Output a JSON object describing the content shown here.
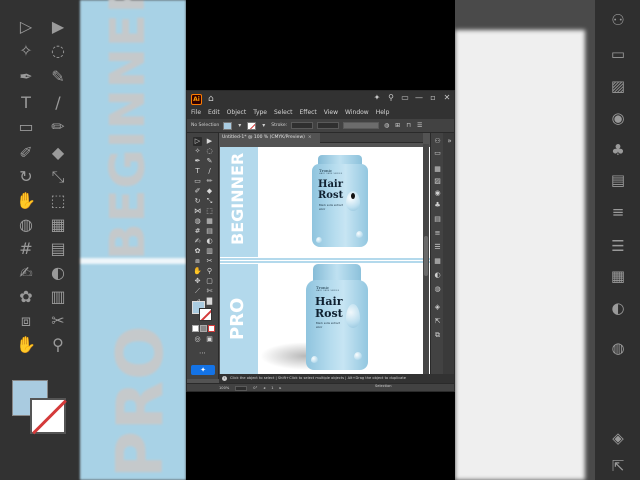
{
  "app": {
    "titlebar_icons": [
      "home-icon",
      "share-icon",
      "search-icon",
      "arrange-icon",
      "minimize-icon",
      "maximize-icon",
      "close-icon"
    ],
    "menu": [
      "File",
      "Edit",
      "Object",
      "Type",
      "Select",
      "Effect",
      "View",
      "Window",
      "Help"
    ],
    "control_bar": {
      "selection_label": "No Selection",
      "stroke_label": "Stroke:",
      "fill_color": "#a9cbe0"
    },
    "document_tab": {
      "label": "Untitled-1* @ 100 % (CMYK/Preview)",
      "close": "×"
    },
    "hint": {
      "text": "Click the object to select  |  Shift+Click to select multiple objects  |  Alt+Drag the object to duplicate"
    },
    "status": {
      "zoom": "100%",
      "angle": "0°",
      "artboard": "1",
      "tool": "Selection"
    }
  },
  "artboard": {
    "accent_color": "#b3d9ec",
    "top_label": "BEGINNER",
    "bottom_label": "PRO",
    "beginner_bottle": {
      "brand": "Tronic",
      "brand_sub": "HAIR CARE SERIES",
      "title_line1": "Hair",
      "title_line2": "Rost",
      "subtitle_line1": "Black soda extract",
      "subtitle_line2": "elixir"
    },
    "pro_bottle": {
      "brand": "Tronic",
      "brand_sub": "HAIR CARE SERIES",
      "title_line1": "Hair",
      "title_line2": "Rost",
      "subtitle_line1": "Black soda extract",
      "subtitle_line2": "elixir"
    }
  },
  "background": {
    "left_words": [
      "BEGINNER",
      "PRO"
    ]
  }
}
